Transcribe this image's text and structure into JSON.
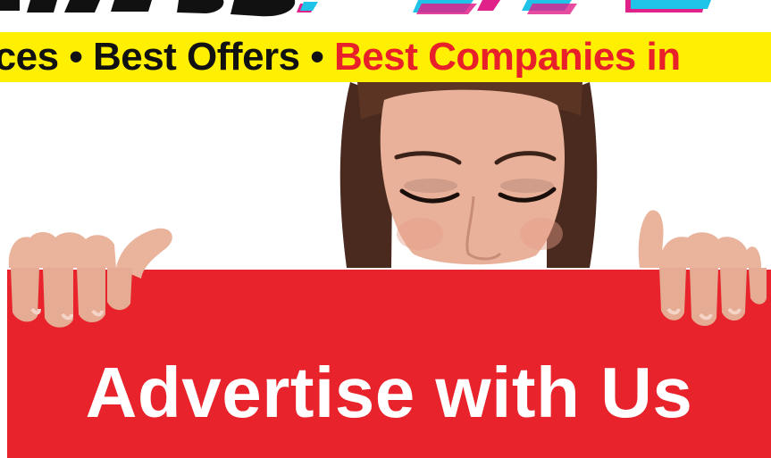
{
  "tagline": {
    "part_dark": "vices • Best Offers • ",
    "part_red": "Best Companies in"
  },
  "sign": {
    "label": "Advertise with Us"
  },
  "colors": {
    "tagline_background": "#ffef00",
    "sign_background": "#e8232b",
    "sign_text": "#ffffff",
    "accent_red": "#e8202a",
    "logo_cyan": "#1fc3e8",
    "logo_magenta": "#e0218a"
  },
  "icons": [
    "logo-mark",
    "person-illustration",
    "left-hand",
    "right-hand"
  ]
}
